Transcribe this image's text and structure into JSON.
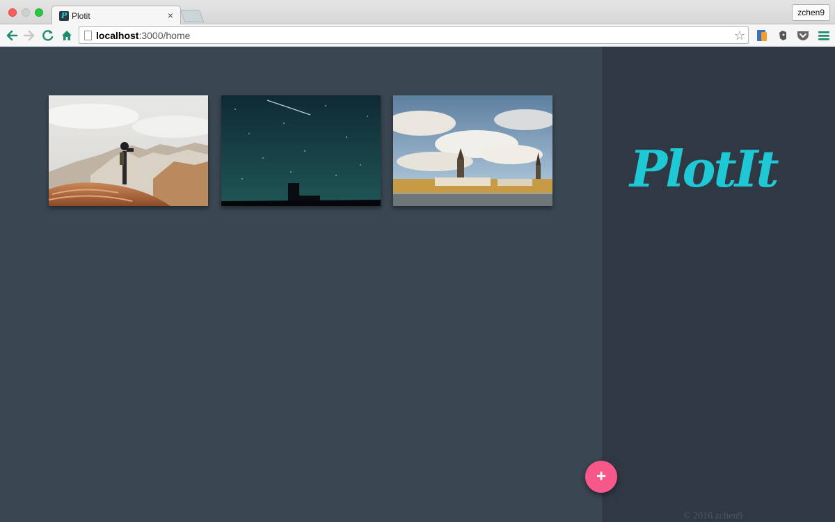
{
  "browser": {
    "tab_title": "Plotit",
    "tab_favicon_letter": "P",
    "tab_close": "×",
    "profile_name": "zchen9",
    "url_host": "localhost",
    "url_path": ":3000/home",
    "icons": {
      "back": "back-arrow-icon",
      "forward": "forward-arrow-icon",
      "reload": "reload-icon",
      "home": "home-icon",
      "bookmark": "star-icon",
      "menu": "hamburger-menu-icon"
    },
    "colors": {
      "nav_accent": "#1f8a6e"
    }
  },
  "app": {
    "logo": "PlotIt",
    "add_button": "+",
    "footer": "© 2016 zchen9",
    "photos": [
      {
        "subject": "hiker-on-rock"
      },
      {
        "subject": "night-sky"
      },
      {
        "subject": "city-skyline"
      }
    ],
    "colors": {
      "main_bg": "#3a4651",
      "sidebar_bg": "#303844",
      "logo": "#1fc8d5",
      "fab": "#f6588a"
    }
  }
}
